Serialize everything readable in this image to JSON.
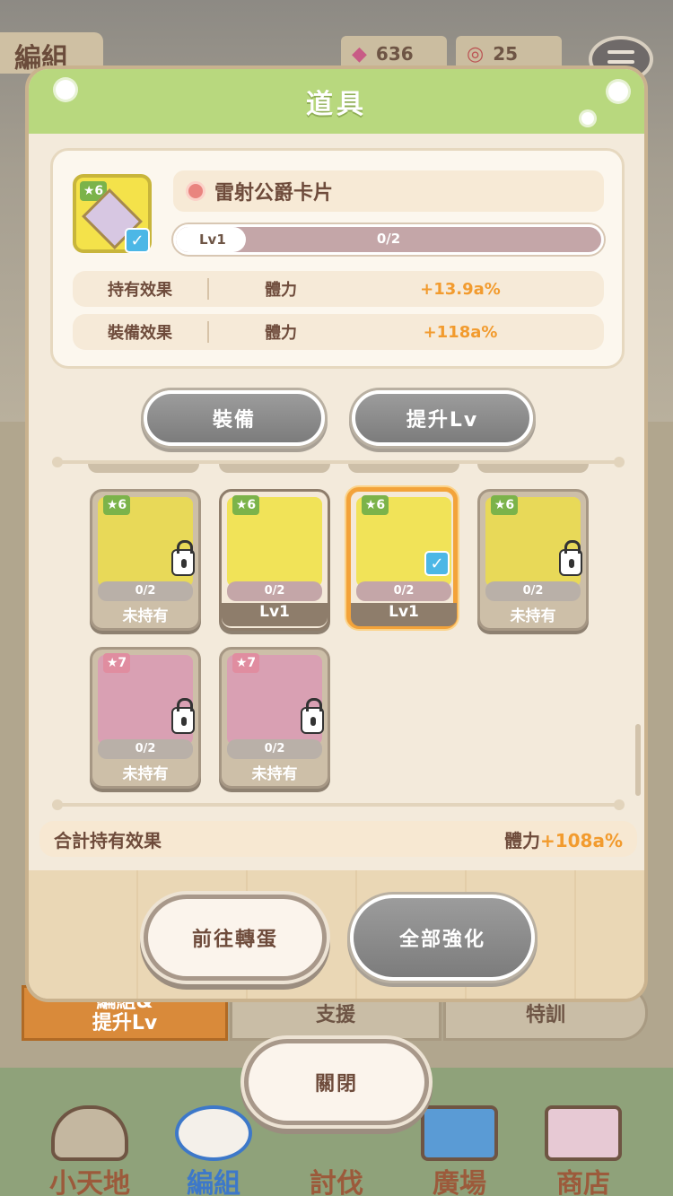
{
  "header": {
    "tab_label": "編組",
    "candy_count": "636",
    "spiral_count": "25"
  },
  "modal": {
    "title": "道具",
    "selected_item": {
      "star_level": "6",
      "name": "雷射公爵卡片",
      "lv_label": "Lv1",
      "lv_progress": "0/2",
      "lv_progress_fraction": 0.0,
      "effects": [
        {
          "label": "持有效果",
          "stat": "體力",
          "value": "+13.9a%"
        },
        {
          "label": "裝備效果",
          "stat": "體力",
          "value": "+118a%"
        }
      ]
    },
    "equip_label": "裝備",
    "upgrade_label": "提升Lv",
    "items": [
      {
        "star": "6",
        "progress": "0/2",
        "status": "未持有",
        "locked": true,
        "color": "#f1e358",
        "icon": "cloth-icon"
      },
      {
        "star": "6",
        "progress": "0/2",
        "status": "Lv1",
        "locked": false,
        "color": "#f1e358",
        "icon": "key-icon"
      },
      {
        "star": "6",
        "progress": "0/2",
        "status": "Lv1",
        "locked": false,
        "selected": true,
        "color": "#f1e358",
        "icon": "laser-card-icon"
      },
      {
        "star": "6",
        "progress": "0/2",
        "status": "未持有",
        "locked": true,
        "color": "#f1e358",
        "icon": "crown-icon"
      },
      {
        "star": "7",
        "progress": "0/2",
        "status": "未持有",
        "locked": true,
        "color": "#e7a3b8",
        "icon": "bear-icon"
      },
      {
        "star": "7",
        "progress": "0/2",
        "status": "未持有",
        "locked": true,
        "color": "#e7a3b8",
        "icon": "red-cloth-icon"
      }
    ],
    "total_label": "合計持有效果",
    "total_stat": "體力",
    "total_value": "+108a%",
    "gacha_label": "前往轉蛋",
    "enhance_all_label": "全部強化"
  },
  "background": {
    "subtab_left": "編組&\n提升Lv",
    "subtab_mid": "支援",
    "subtab_right": "特訓"
  },
  "close_label": "關閉",
  "nav": [
    "小天地",
    "編組",
    "討伐",
    "廣場",
    "商店"
  ]
}
